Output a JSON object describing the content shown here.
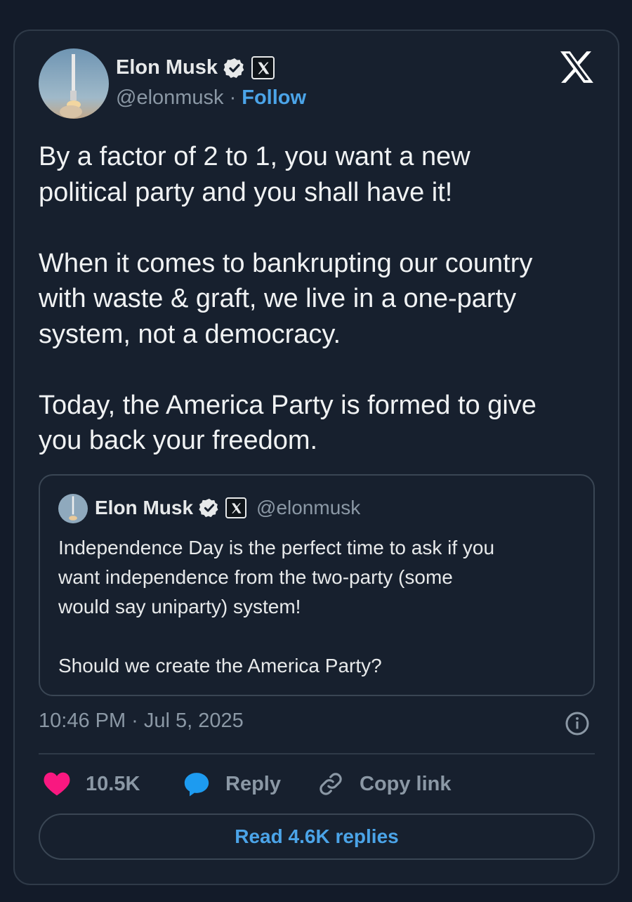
{
  "tweet": {
    "author": {
      "name": "Elon Musk",
      "handle": "@elonmusk",
      "follow_label": "Follow",
      "handle_separator": "·"
    },
    "text": "By a factor of 2 to 1, you want a new\npolitical party and you shall have it!\n\nWhen it comes to bankrupting our country\nwith waste & graft, we live in a one-party\nsystem, not a democracy.\n\nToday, the America Party is formed to give\nyou back your freedom.",
    "quote": {
      "name": "Elon Musk",
      "handle": "@elonmusk",
      "text": "Independence Day is the perfect time to ask if you\nwant independence from the two-party (some\nwould say uniparty) system!\n\nShould we create the America Party?"
    },
    "timestamp": "10:46 PM · Jul 5, 2025",
    "actions": {
      "likes": "10.5K",
      "reply_label": "Reply",
      "copy_label": "Copy link"
    },
    "read_replies_label": "Read 4.6K replies"
  },
  "colors": {
    "background": "#17202e",
    "accent": "#4ba4e8",
    "like": "#f91880",
    "reply_icon": "#1d9bf0",
    "muted": "#8b98a5"
  },
  "icons": [
    "verified-badge-icon",
    "x-affiliation-icon",
    "x-logo-icon",
    "info-icon",
    "heart-icon",
    "reply-bubble-icon",
    "link-icon"
  ]
}
